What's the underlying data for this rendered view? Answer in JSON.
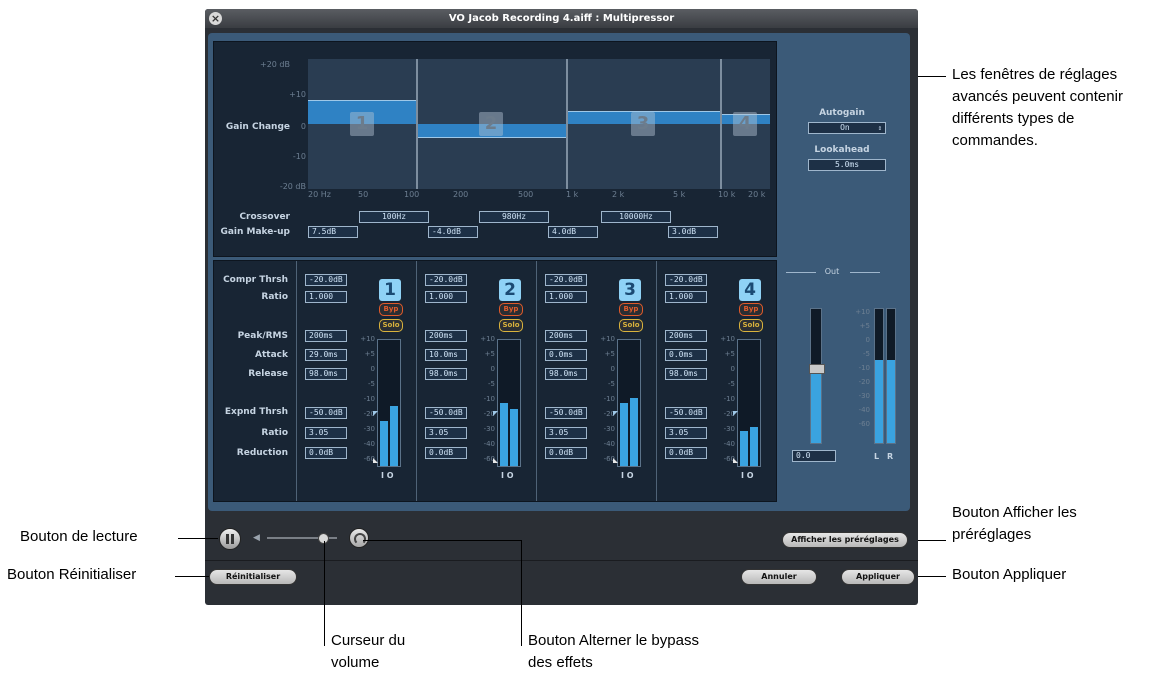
{
  "window": {
    "title": "VO Jacob Recording 4.aiff : Multipressor"
  },
  "graph": {
    "y_label": "Gain Change",
    "y_ticks": [
      "+20 dB",
      "+10",
      "0",
      "-10",
      "-20 dB"
    ],
    "x_ticks": [
      "20 Hz",
      "50",
      "100",
      "200",
      "500",
      "1 k",
      "2 k",
      "5 k",
      "10 k",
      "20 k"
    ],
    "band_numbers": [
      "1",
      "2",
      "3",
      "4"
    ],
    "band_gains": [
      7.5,
      -4.0,
      4.0,
      3.0
    ]
  },
  "crossover": {
    "label": "Crossover",
    "values": [
      "100Hz",
      "980Hz",
      "10000Hz"
    ]
  },
  "gain_makeup": {
    "label": "Gain Make-up",
    "values": [
      "7.5dB",
      "-4.0dB",
      "4.0dB",
      "3.0dB"
    ]
  },
  "side": {
    "autogain_label": "Autogain",
    "autogain_value": "On",
    "lookahead_label": "Lookahead",
    "lookahead_value": "5.0ms"
  },
  "rows": {
    "compr_thrsh": "Compr Thrsh",
    "ratio": "Ratio",
    "peak_rms": "Peak/RMS",
    "attack": "Attack",
    "release": "Release",
    "expnd_thrsh": "Expnd Thrsh",
    "ratio2": "Ratio",
    "reduction": "Reduction"
  },
  "bands": [
    {
      "num": "1",
      "compr": "-20.0dB",
      "ratio": "1.000",
      "peak": "200ms",
      "attack": "29.0ms",
      "release": "98.0ms",
      "expnd": "-50.0dB",
      "ratio2": "3.05",
      "reduction": "0.0dB",
      "in": 0.36,
      "out": 0.48
    },
    {
      "num": "2",
      "compr": "-20.0dB",
      "ratio": "1.000",
      "peak": "200ms",
      "attack": "10.0ms",
      "release": "98.0ms",
      "expnd": "-50.0dB",
      "ratio2": "3.05",
      "reduction": "0.0dB",
      "in": 0.5,
      "out": 0.45
    },
    {
      "num": "3",
      "compr": "-20.0dB",
      "ratio": "1.000",
      "peak": "200ms",
      "attack": "0.0ms",
      "release": "98.0ms",
      "expnd": "-50.0dB",
      "ratio2": "3.05",
      "reduction": "0.0dB",
      "in": 0.5,
      "out": 0.54
    },
    {
      "num": "4",
      "compr": "-20.0dB",
      "ratio": "1.000",
      "peak": "200ms",
      "attack": "0.0ms",
      "release": "98.0ms",
      "expnd": "-50.0dB",
      "ratio2": "3.05",
      "reduction": "0.0dB",
      "in": 0.28,
      "out": 0.31
    }
  ],
  "meter": {
    "byp": "Byp",
    "solo": "Solo",
    "io": "I O",
    "ticks": [
      "+10",
      "+5",
      "0",
      "-5",
      "-10",
      "-20",
      "-30",
      "-40",
      "-60"
    ]
  },
  "out": {
    "label": "Out",
    "value": "0.0",
    "ticks": [
      "+10",
      "+5",
      "0",
      "-5",
      "-10",
      "-20",
      "-30",
      "-40",
      "-60"
    ],
    "l": "L",
    "r": "R",
    "level_l": 0.62,
    "level_r": 0.62,
    "fader": 0.56
  },
  "controls": {
    "show_presets": "Afficher les préréglages",
    "reset": "Réinitialiser",
    "cancel": "Annuler",
    "apply": "Appliquer",
    "volume": 0.78
  },
  "callouts": {
    "advanced": "Les fenêtres de réglages avancés peuvent contenir différents types de commandes.",
    "play": "Bouton de lecture",
    "reset": "Bouton Réinitialiser",
    "show_presets": "Bouton Afficher les préréglages",
    "apply": "Bouton Appliquer",
    "volume": "Curseur du volume",
    "bypass": "Bouton Alterner le bypass des effets"
  }
}
